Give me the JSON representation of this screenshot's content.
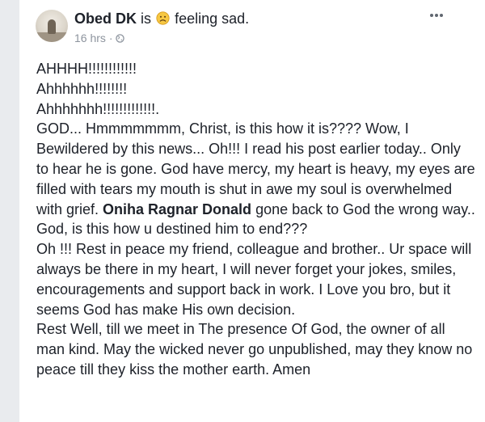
{
  "post": {
    "author": "Obed DK",
    "is_text": "is",
    "feeling_icon": "sad-face-icon",
    "feeling_text": "feeling sad.",
    "time": "16 hrs",
    "separator": "·",
    "privacy_icon": "globe-icon",
    "more_icon": "more-options-icon",
    "body": {
      "line1": "AHHHH!!!!!!!!!!!!",
      "line2": "Ahhhhhh!!!!!!!!",
      "line3": "Ahhhhhhh!!!!!!!!!!!!!.",
      "p1": "GOD... Hmmmmmmm, Christ, is this how it is???? Wow, I Bewildered by this news... Oh!!! I read his post earlier today.. Only to hear he is gone. God have mercy, my heart is heavy, my eyes are filled with tears my mouth is shut in awe my soul is overwhelmed with grief. ",
      "mention": "Oniha Ragnar Donald",
      "p1_end": " gone back to God the wrong way.. God, is this how u destined him to end???",
      "p2": "Oh !!! Rest in peace my friend, colleague and brother.. Ur space will always be there in my heart, I will never forget your jokes, smiles, encouragements and support back in work. I Love you bro, but it seems God has make His own decision.",
      "p3": "Rest Well, till we meet in The presence Of God, the owner of all man kind. May the wicked never go unpublished, may they know no peace till they kiss the mother earth. Amen"
    }
  },
  "colors": {
    "text": "#1d2129",
    "meta": "#8d949e",
    "background": "#e9ebee",
    "card": "#ffffff",
    "emoji_face": "#f7c843"
  }
}
